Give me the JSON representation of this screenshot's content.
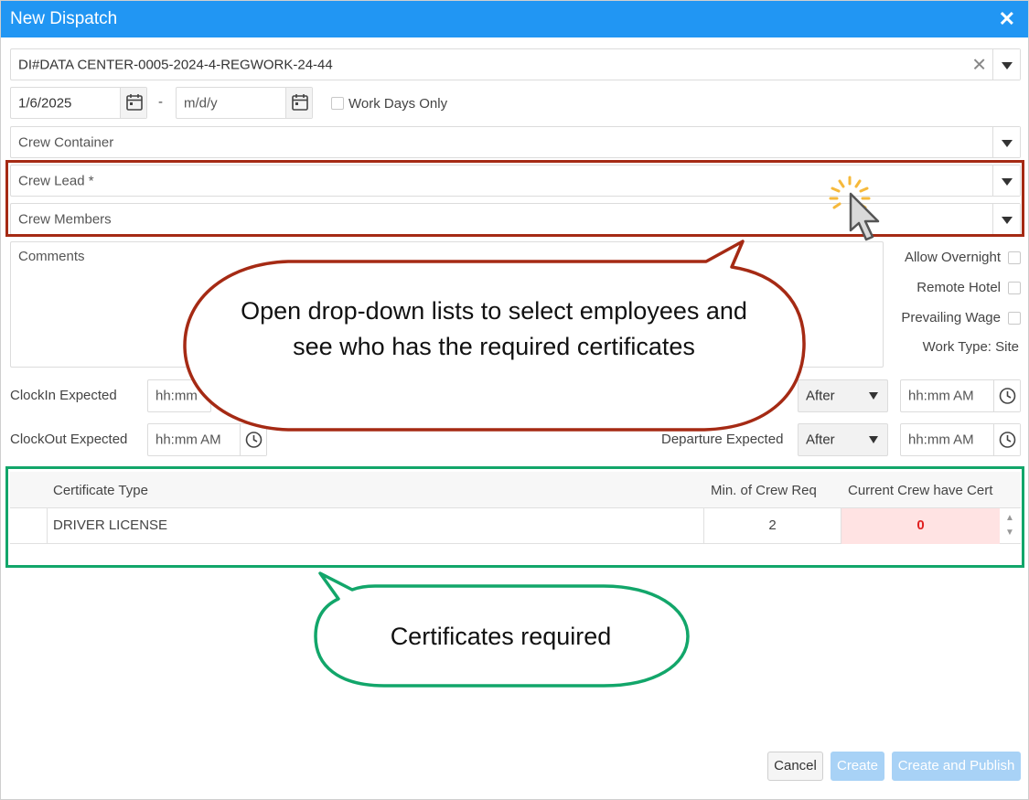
{
  "dialog": {
    "title": "New Dispatch"
  },
  "job": {
    "value": "DI#DATA CENTER-0005-2024-4-REGWORK-24-44"
  },
  "dates": {
    "start": "1/6/2025",
    "separator": "-",
    "end_placeholder": "m/d/y",
    "work_days_only": "Work Days Only"
  },
  "crew": {
    "container_placeholder": "Crew Container",
    "lead_placeholder": "Crew Lead *",
    "members_placeholder": "Crew Members"
  },
  "comments": {
    "placeholder": "Comments"
  },
  "options": {
    "allow_overnight": "Allow Overnight",
    "remote_hotel": "Remote Hotel",
    "prevailing_wage": "Prevailing Wage",
    "work_type": "Work Type: Site"
  },
  "times": {
    "clockin_label": "ClockIn Expected",
    "clockout_label": "ClockOut Expected",
    "clockin_placeholder": "hh:mm",
    "time_placeholder": "hh:mm AM",
    "departure_label": "Departure Expected",
    "arrival_relation": "After",
    "departure_relation": "After"
  },
  "certificates": {
    "headers": [
      "Certificate Type",
      "Min. of Crew Req",
      "Current Crew have Cert"
    ],
    "rows": [
      {
        "type": "DRIVER LICENSE",
        "min_required": "2",
        "current": "0"
      }
    ]
  },
  "callouts": {
    "dropdowns": "Open drop-down lists to select employees and see who has the required certificates",
    "certificates": "Certificates required"
  },
  "buttons": {
    "cancel": "Cancel",
    "create": "Create",
    "create_publish": "Create and Publish"
  },
  "colors": {
    "titlebar": "#2196f3",
    "highlight_red": "#a52a14",
    "highlight_green": "#12a66a",
    "warning_cell": "#ffe3e3",
    "warning_text": "#e02020",
    "disabled_button": "#a8d2f6"
  },
  "icons": {
    "close": "close-icon",
    "calendar": "calendar-icon",
    "clock": "clock-icon",
    "dropdown": "chevron-down-icon",
    "cursor": "cursor-click-icon"
  }
}
